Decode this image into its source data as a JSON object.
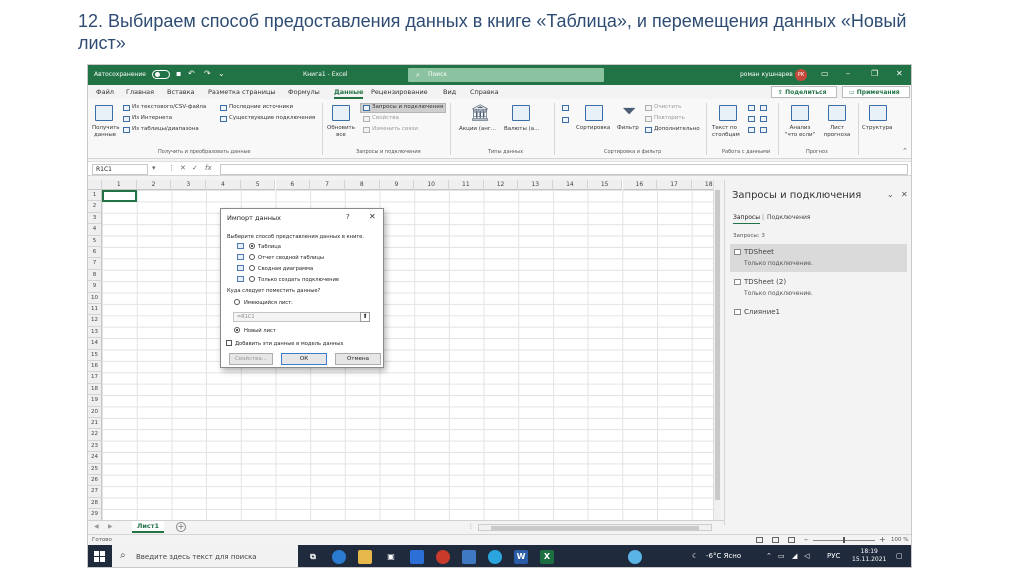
{
  "slide": {
    "title": "12. Выбираем способ предоставления данных в книге «Таблица», и перемещения данных «Новый лист»"
  },
  "titlebar": {
    "autosave_label": "Автосохранение",
    "doc_title": "Книга1 - Excel",
    "search_placeholder": "Поиск",
    "user_name": "роман кушнарев",
    "user_initials": "РК"
  },
  "ribbon_tabs": [
    "Файл",
    "Главная",
    "Вставка",
    "Разметка страницы",
    "Формулы",
    "Данные",
    "Рецензирование",
    "Вид",
    "Справка"
  ],
  "ribbon_active_tab": "Данные",
  "ribbon_buttons": {
    "share": "Поделиться",
    "notes": "Примечания"
  },
  "ribbon": {
    "get_data": "Получить данные",
    "from_csv": "Из текстового/CSV-файла",
    "from_web": "Из Интернета",
    "from_table": "Из таблицы/диапазона",
    "recent_sources": "Последние источники",
    "existing_connections": "Существующие подключения",
    "group_get": "Получить и преобразовать данные",
    "refresh_all": "Обновить все",
    "queries_connections": "Запросы и подключения",
    "properties": "Свойства",
    "edit_links": "Изменить связи",
    "group_queries": "Запросы и подключения",
    "stocks": "Акции (анг...",
    "currencies": "Валюты (а...",
    "group_types": "Типы данных",
    "sort": "Сортировка",
    "filter": "Фильтр",
    "clear": "Очистить",
    "reapply": "Повторить",
    "advanced": "Дополнительно",
    "group_sort": "Сортировка и фильтр",
    "text_to_columns": "Текст по столбцам",
    "group_tools": "Работа с данными",
    "what_if": "Анализ \"что если\"",
    "forecast_sheet": "Лист прогноза",
    "group_forecast": "Прогноз",
    "outline": "Структура"
  },
  "formula_bar": {
    "name_box": "R1C1",
    "fx": "fx"
  },
  "columns": [
    "1",
    "2",
    "3",
    "4",
    "5",
    "6",
    "7",
    "8",
    "9",
    "10",
    "11",
    "12",
    "13",
    "14",
    "15",
    "16",
    "17",
    "18"
  ],
  "rows": [
    "1",
    "2",
    "3",
    "4",
    "5",
    "6",
    "7",
    "8",
    "9",
    "10",
    "11",
    "12",
    "13",
    "14",
    "15",
    "16",
    "17",
    "18",
    "19",
    "20",
    "21",
    "22",
    "23",
    "24",
    "25",
    "26",
    "27",
    "28",
    "29"
  ],
  "dialog": {
    "title": "Импорт данных",
    "help": "?",
    "close": "✕",
    "prompt_view": "Выберите способ представления данных в книге.",
    "options": [
      {
        "label": "Таблица",
        "selected": true
      },
      {
        "label": "Отчет сводной таблицы",
        "selected": false
      },
      {
        "label": "Сводная диаграмма",
        "selected": false
      },
      {
        "label": "Только создать подключение",
        "selected": false
      }
    ],
    "prompt_place": "Куда следует поместить данные?",
    "existing_sheet": "Имеющийся лист:",
    "range_value": "=R1C1",
    "new_sheet": "Новый лист",
    "new_sheet_selected": true,
    "add_to_model": "Добавить эти данные в модель данных",
    "add_to_model_checked": false,
    "properties_btn": "Свойства...",
    "ok_btn": "ОК",
    "cancel_btn": "Отмена"
  },
  "pane": {
    "title": "Запросы и подключения",
    "tab_queries": "Запросы",
    "tab_connections": "Подключения",
    "count": "Запросы: 3",
    "items": [
      {
        "name": "TDSheet",
        "desc": "Только подключение."
      },
      {
        "name": "TDSheet (2)",
        "desc": "Только подключение."
      },
      {
        "name": "Слияние1",
        "desc": ""
      }
    ]
  },
  "sheet_tab": "Лист1",
  "status": {
    "ready": "Готово",
    "zoom": "100 %"
  },
  "taskbar": {
    "search_text": "Введите здесь текст для поиска",
    "weather": "-6°C Ясно",
    "lang": "РУС",
    "time": "18:19",
    "date": "15.11.2021"
  },
  "colors": {
    "excel_green": "#217346",
    "taskbar": "#1f2b3d",
    "slide_title": "#2e4c73"
  }
}
